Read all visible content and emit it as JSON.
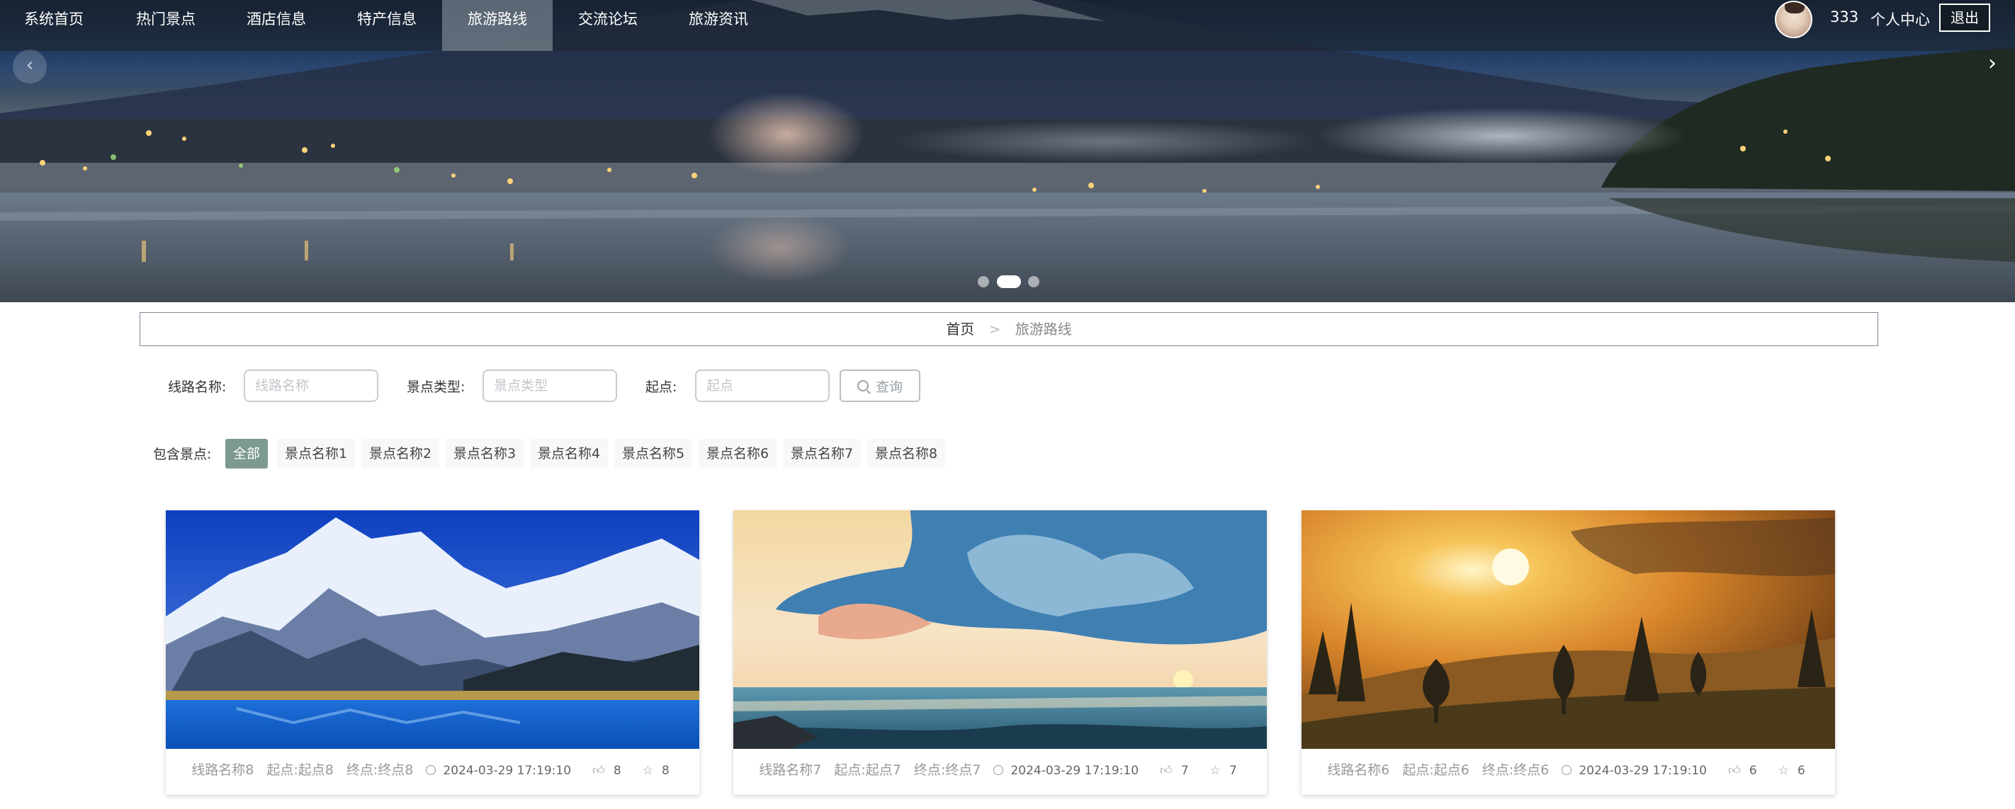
{
  "nav": {
    "items": [
      {
        "label": "系统首页",
        "active": false
      },
      {
        "label": "热门景点",
        "active": false
      },
      {
        "label": "酒店信息",
        "active": false
      },
      {
        "label": "特产信息",
        "active": false
      },
      {
        "label": "旅游路线",
        "active": true
      },
      {
        "label": "交流论坛",
        "active": false
      },
      {
        "label": "旅游资讯",
        "active": false
      }
    ],
    "username": "333",
    "personal_center": "个人中心",
    "logout": "退出"
  },
  "carousel": {
    "prev_icon": "‹",
    "next_icon": "›",
    "dot_count": 3,
    "active_dot": 1
  },
  "breadcrumb": {
    "home": "首页",
    "separator": ">",
    "current": "旅游路线"
  },
  "search": {
    "route_name_label": "线路名称:",
    "route_name_placeholder": "线路名称",
    "spot_type_label": "景点类型:",
    "spot_type_placeholder": "景点类型",
    "start_label": "起点:",
    "start_placeholder": "起点",
    "button": "查询"
  },
  "filter": {
    "label": "包含景点:",
    "tags": [
      "全部",
      "景点名称1",
      "景点名称2",
      "景点名称3",
      "景点名称4",
      "景点名称5",
      "景点名称6",
      "景点名称7",
      "景点名称8"
    ],
    "active_index": 0
  },
  "cards": [
    {
      "name": "线路名称8",
      "start": "起点:起点8",
      "end": "终点:终点8",
      "time": "2024-03-29 17:19:10",
      "likes": "8",
      "favorites": "8"
    },
    {
      "name": "线路名称7",
      "start": "起点:起点7",
      "end": "终点:终点7",
      "time": "2024-03-29 17:19:10",
      "likes": "7",
      "favorites": "7"
    },
    {
      "name": "线路名称6",
      "start": "起点:起点6",
      "end": "终点:终点6",
      "time": "2024-03-29 17:19:10",
      "likes": "6",
      "favorites": "6"
    }
  ],
  "colors": {
    "accent_tag": "#7d9a90",
    "nav_bg": "#1e2630"
  }
}
